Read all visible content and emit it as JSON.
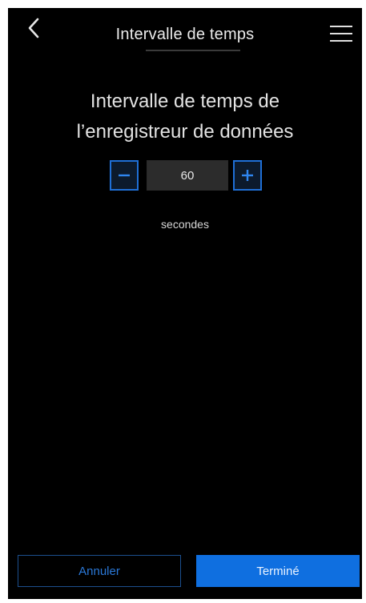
{
  "header": {
    "title": "Intervalle de temps",
    "back_icon": "chevron-left-icon",
    "menu_icon": "hamburger-menu-icon"
  },
  "main": {
    "heading_line1": "Intervalle de temps de",
    "heading_line2": "l’enregistreur de données",
    "interval_value": "60",
    "unit_label": "secondes",
    "decrement_icon": "minus-icon",
    "increment_icon": "plus-icon"
  },
  "footer": {
    "cancel_label": "Annuler",
    "done_label": "Terminé"
  },
  "colors": {
    "background": "#000000",
    "accent": "#0f6fe0",
    "value_box": "#2c2c2c"
  }
}
